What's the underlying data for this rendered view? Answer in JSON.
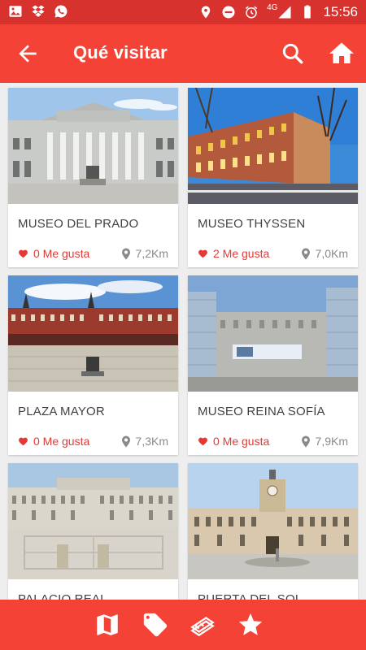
{
  "status_bar": {
    "time": "15:56",
    "network": "4G",
    "left_icons": [
      "image-icon",
      "dropbox-icon",
      "whatsapp-icon"
    ],
    "right_icons": [
      "location-icon",
      "do-not-disturb-icon",
      "alarm-icon",
      "signal-icon",
      "battery-icon"
    ]
  },
  "app_bar": {
    "title": "Qué visitar",
    "back_icon": "arrow-back-icon",
    "search_icon": "search-icon",
    "home_icon": "home-icon"
  },
  "places": [
    {
      "name": "MUSEO DEL PRADO",
      "likes": "0 Me gusta",
      "distance": "7,2Km"
    },
    {
      "name": "MUSEO THYSSEN",
      "likes": "2 Me gusta",
      "distance": "7,0Km"
    },
    {
      "name": "PLAZA MAYOR",
      "likes": "0 Me gusta",
      "distance": "7,3Km"
    },
    {
      "name": "MUSEO REINA SOFÍA",
      "likes": "0 Me gusta",
      "distance": "7,9Km"
    },
    {
      "name": "PALACIO REAL",
      "likes": "",
      "distance": ""
    },
    {
      "name": "PUERTA DEL SOL",
      "likes": "",
      "distance": ""
    }
  ],
  "bottom_nav": {
    "items": [
      "map-icon",
      "tag-icon",
      "tickets-icon",
      "star-icon"
    ]
  },
  "colors": {
    "primary": "#f44336",
    "status_bar": "#d8322f",
    "like": "#e53935",
    "background": "#eeeeee"
  }
}
